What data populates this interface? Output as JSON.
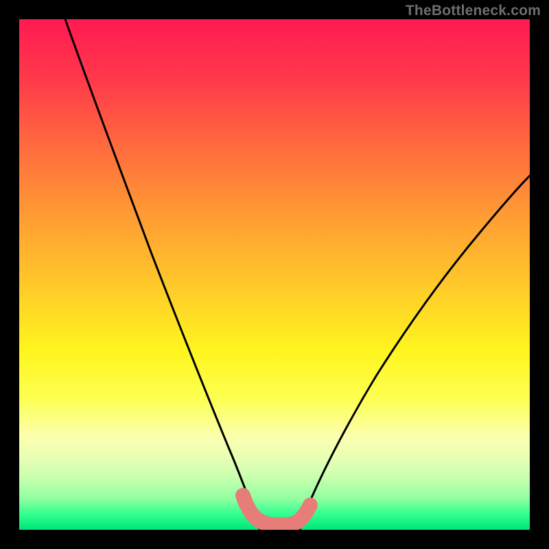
{
  "watermark": {
    "text": "TheBottleneck.com"
  },
  "chart_data": {
    "type": "line",
    "title": "",
    "xlabel": "",
    "ylabel": "",
    "xlim": [
      0,
      100
    ],
    "ylim": [
      0,
      100
    ],
    "grid": false,
    "legend": false,
    "series": [
      {
        "name": "left-curve",
        "x": [
          9,
          14,
          20,
          26,
          32,
          37,
          41,
          44,
          46,
          47
        ],
        "y": [
          100,
          86,
          70,
          54,
          38,
          24,
          13,
          6,
          2,
          0
        ]
      },
      {
        "name": "right-curve",
        "x": [
          55,
          57,
          60,
          64,
          69,
          75,
          82,
          90,
          100
        ],
        "y": [
          0,
          4,
          9,
          16,
          25,
          36,
          48,
          60,
          73
        ]
      },
      {
        "name": "trough-marker",
        "x": [
          44,
          46,
          48,
          51,
          54,
          56,
          57
        ],
        "y": [
          5,
          1,
          0,
          0,
          0,
          1,
          3
        ]
      }
    ],
    "colors": {
      "curve": "#000000",
      "marker": "#e77d79",
      "gradient_top": "#ff1a52",
      "gradient_bottom": "#00e57a"
    }
  }
}
